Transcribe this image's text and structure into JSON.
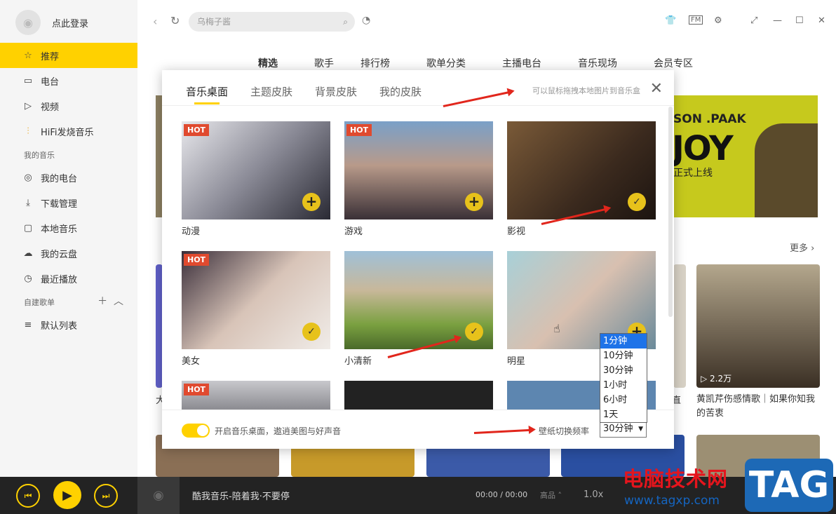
{
  "sidebar": {
    "login_label": "点此登录",
    "items": [
      {
        "label": "推荐",
        "icon": "star-icon"
      },
      {
        "label": "电台",
        "icon": "radio-icon"
      },
      {
        "label": "视频",
        "icon": "video-icon"
      },
      {
        "label": "HiFi发烧音乐",
        "icon": "hifi-icon"
      }
    ],
    "my_music_header": "我的音乐",
    "my_music": [
      {
        "label": "我的电台",
        "icon": "my-radio-icon"
      },
      {
        "label": "下载管理",
        "icon": "download-icon"
      },
      {
        "label": "本地音乐",
        "icon": "monitor-icon"
      },
      {
        "label": "我的云盘",
        "icon": "cloud-icon"
      },
      {
        "label": "最近播放",
        "icon": "clock-icon"
      }
    ],
    "playlist_header": "自建歌单",
    "playlists": [
      {
        "label": "默认列表",
        "icon": "playlist-icon"
      }
    ]
  },
  "topbar": {
    "search_placeholder": "乌梅子酱"
  },
  "tabs": [
    "精选",
    "歌手",
    "排行榜",
    "歌单分类",
    "主播电台",
    "音乐现场",
    "会员专区"
  ],
  "main": {
    "more_label": "更多",
    "banner_line1": "SON .PAAK",
    "banner_line2": "JOY",
    "banner_line3": "正式上线",
    "play_count": "2.2万",
    "card_title": "黄凯芹伤感情歌｜如果你知我的苦衷",
    "card_left_partial": "大",
    "card_right_partial": "直"
  },
  "dialog": {
    "tabs": [
      "音乐桌面",
      "主题皮肤",
      "背景皮肤",
      "我的皮肤"
    ],
    "hint": "可以鼠标拖拽本地图片到音乐盒",
    "tiles": [
      {
        "label": "动漫",
        "hot": "HOT",
        "state": "add"
      },
      {
        "label": "游戏",
        "hot": "HOT",
        "state": "add"
      },
      {
        "label": "影视",
        "hot": "",
        "state": "check"
      },
      {
        "label": "美女",
        "hot": "HOT",
        "state": "check"
      },
      {
        "label": "小清新",
        "hot": "",
        "state": "check"
      },
      {
        "label": "明星",
        "hot": "",
        "state": "add"
      }
    ],
    "row3_hot": "HOT",
    "footer_text": "开启音乐桌面，遨逍美图与好声音",
    "freq_label": "壁纸切换频率",
    "freq_value": "30分钟",
    "options": [
      "1分钟",
      "10分钟",
      "30分钟",
      "1小时",
      "6小时",
      "1天"
    ],
    "highlighted_option": "1分钟"
  },
  "player": {
    "title": "酷我音乐-陪着我·不要停",
    "time": "00:00 / 00:00",
    "quality": "高品",
    "speed": "1.0x"
  },
  "watermark": {
    "line1": "电脑技术网",
    "line2": "www.tagxp.com",
    "tag": "TAG"
  },
  "colors": {
    "accent": "#ffd100",
    "player_bg": "#232323",
    "hot": "#e04a2f"
  }
}
